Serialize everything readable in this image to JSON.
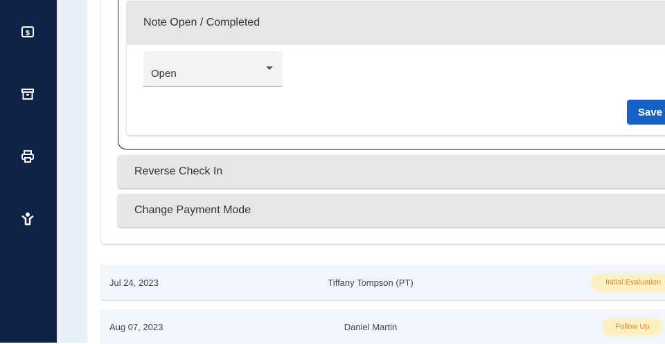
{
  "sidebar": {
    "icons": [
      {
        "name": "billing-icon"
      },
      {
        "name": "archive-icon"
      },
      {
        "name": "print-icon"
      },
      {
        "name": "patient-icon"
      }
    ]
  },
  "note_status": {
    "title": "Note Open / Completed",
    "select_value": "Open",
    "save_label": "Save"
  },
  "actions": {
    "reverse_check_in": "Reverse Check In",
    "change_payment_mode": "Change Payment Mode"
  },
  "appointments": [
    {
      "date": "Jul 24, 2023",
      "provider": "Tiffany Tompson (PT)",
      "type": "Initial Evaluation"
    },
    {
      "date": "Aug 07, 2023",
      "provider": "Daniel Martin",
      "type": "Follow Up"
    }
  ],
  "colors": {
    "sidebar": "#0f2347",
    "primary": "#1761c4",
    "badge_bg": "#fdf1c2",
    "badge_text": "#d9892b"
  }
}
